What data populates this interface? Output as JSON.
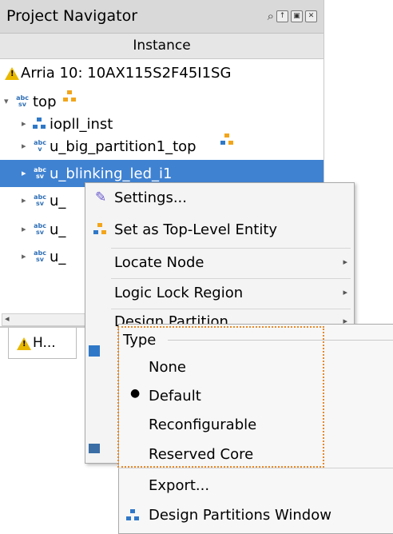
{
  "panel": {
    "title": "Project Navigator",
    "column_header": "Instance",
    "device": "Arria 10: 10AX115S2F45I1SG",
    "top_label": "top",
    "instances": [
      "iopll_inst",
      "u_big_partition1_top",
      "u_blinking_led_i1",
      "u_",
      "u_",
      "u_"
    ],
    "bottom_tab": "H..."
  },
  "icons": {
    "sv": [
      "abc",
      "sv"
    ],
    "verilog": [
      "abc",
      "v"
    ]
  },
  "context_menu": {
    "items": [
      "Settings...",
      "Set as Top-Level Entity",
      "Locate Node",
      "Logic Lock Region",
      "Design Partition"
    ]
  },
  "submenu": {
    "group_label": "Type",
    "options": [
      "None",
      "Default",
      "Reconfigurable",
      "Reserved Core"
    ],
    "selected": "Default",
    "export_label": "Export...",
    "window_label": "Design Partitions Window"
  },
  "colors": {
    "selection": "#3f82d2",
    "highlight_border": "#e8892b"
  }
}
